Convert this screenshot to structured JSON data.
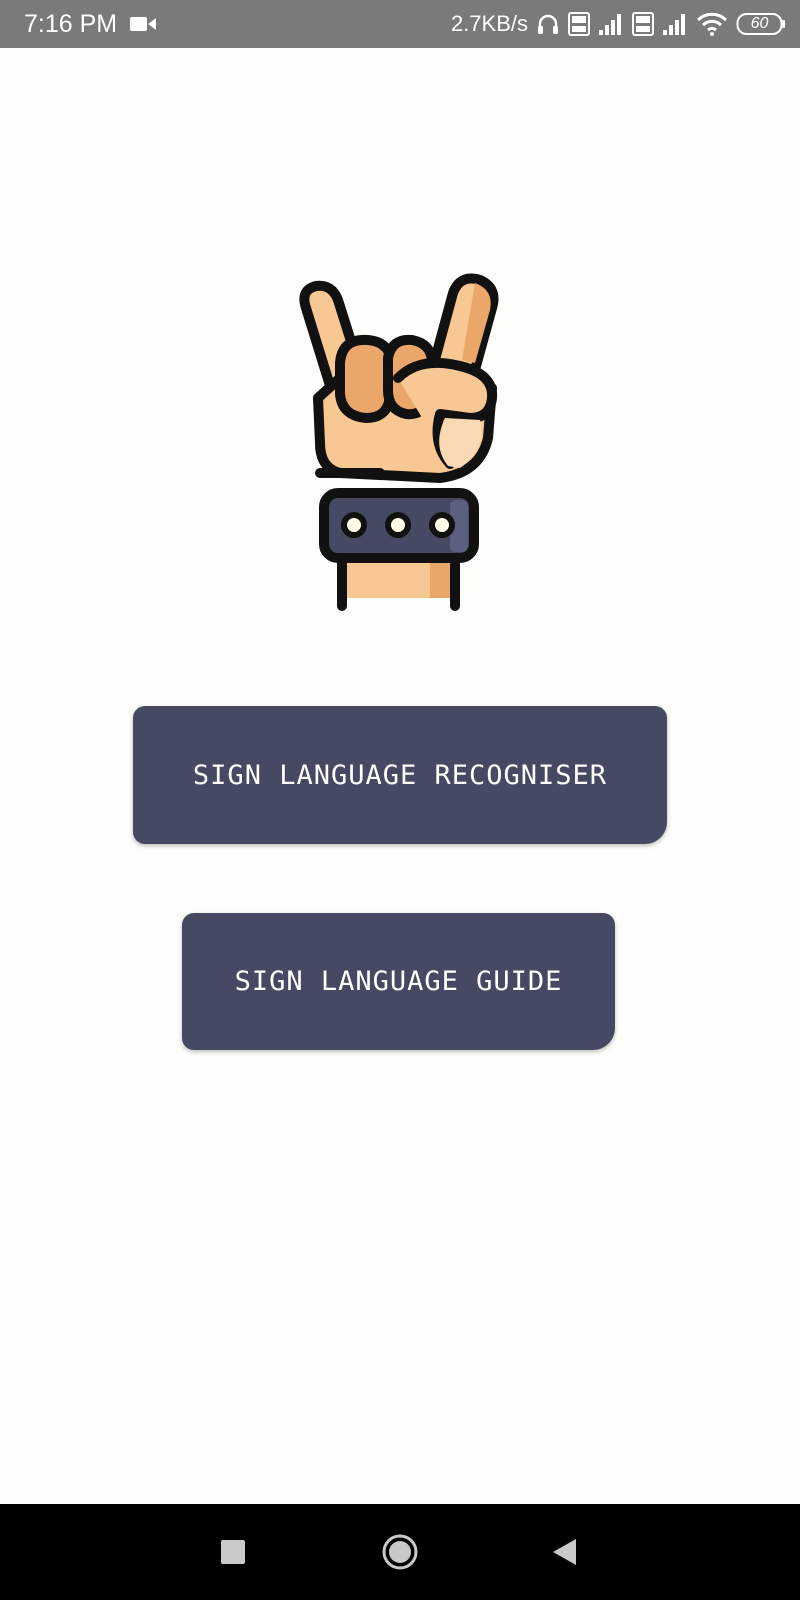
{
  "status_bar": {
    "time": "7:16 PM",
    "network_speed": "2.7KB/s",
    "battery": "60",
    "icons": [
      "video-camera-icon",
      "headset-icon",
      "volte-icon",
      "signal-icon",
      "volte-icon",
      "signal-icon",
      "wifi-icon",
      "battery-icon"
    ]
  },
  "logo": {
    "icon": "rock-hand-sign-icon"
  },
  "buttons": {
    "recogniser_label": "SIGN LANGUAGE RECOGNISER",
    "guide_label": "SIGN LANGUAGE GUIDE"
  },
  "colors": {
    "button_bg": "#464962",
    "status_bar_bg": "#7a7a7a",
    "background": "#fdfdfc"
  },
  "nav_bar": {
    "icons": [
      "recents-square-icon",
      "home-circle-icon",
      "back-triangle-icon"
    ]
  }
}
